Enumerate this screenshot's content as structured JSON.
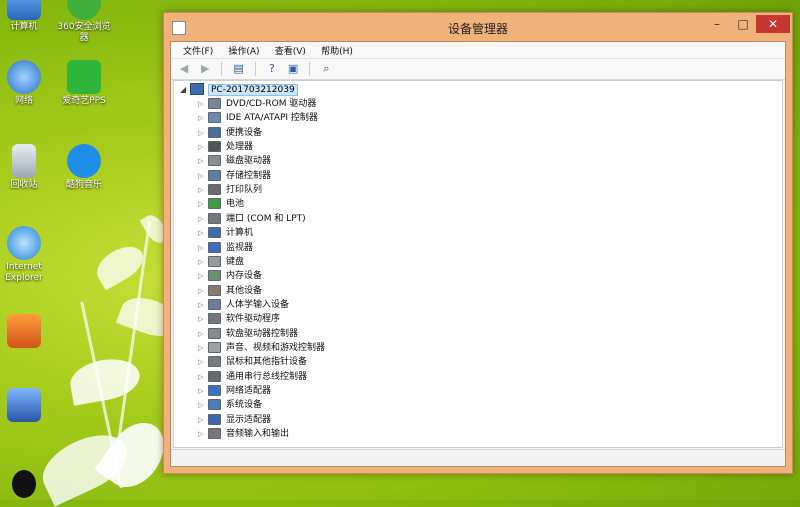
{
  "desktop": {
    "icons": [
      {
        "label": "计算机",
        "icon": "computer-icon"
      },
      {
        "label": "360安全浏览器",
        "icon": "360-browser-icon"
      },
      {
        "label": "网络",
        "icon": "network-icon"
      },
      {
        "label": "爱奇艺PPS",
        "icon": "iqiyi-pps-icon"
      },
      {
        "label": "回收站",
        "icon": "recycle-bin-icon"
      },
      {
        "label": "酷狗音乐",
        "icon": "kugou-music-icon"
      },
      {
        "label": "Internet Explorer",
        "icon": "internet-explorer-icon"
      },
      {
        "label": "",
        "icon": "app-shortcut-icon"
      },
      {
        "label": "",
        "icon": "control-panel-icon"
      },
      {
        "label": "",
        "icon": "qq-icon"
      }
    ]
  },
  "window": {
    "title": "设备管理器",
    "buttons": {
      "minimize": "–",
      "maximize": "□",
      "close": "✕"
    },
    "menu": [
      "文件(F)",
      "操作(A)",
      "查看(V)",
      "帮助(H)"
    ],
    "toolbar": [
      "back-arrow-icon",
      "forward-arrow-icon",
      "properties-icon",
      "help-icon",
      "show-hide-console-icon",
      "scan-hardware-icon"
    ],
    "tree": {
      "root": "PC-20170321203​9",
      "categories": [
        "DVD/CD-ROM 驱动器",
        "IDE ATA/ATAPI 控制器",
        "便携设备",
        "处理器",
        "磁盘驱动器",
        "存储控制器",
        "打印队列",
        "电池",
        "端口 (COM 和 LPT)",
        "计算机",
        "监视器",
        "键盘",
        "内存设备",
        "其他设备",
        "人体学输入设备",
        "软件驱动程序",
        "软盘驱动器控制器",
        "声音、视频和游戏控制器",
        "鼠标和其他指针设备",
        "通用串行总线控制器",
        "网络适配器",
        "系统设备",
        "显示适配器",
        "音频输入和输出"
      ]
    }
  }
}
